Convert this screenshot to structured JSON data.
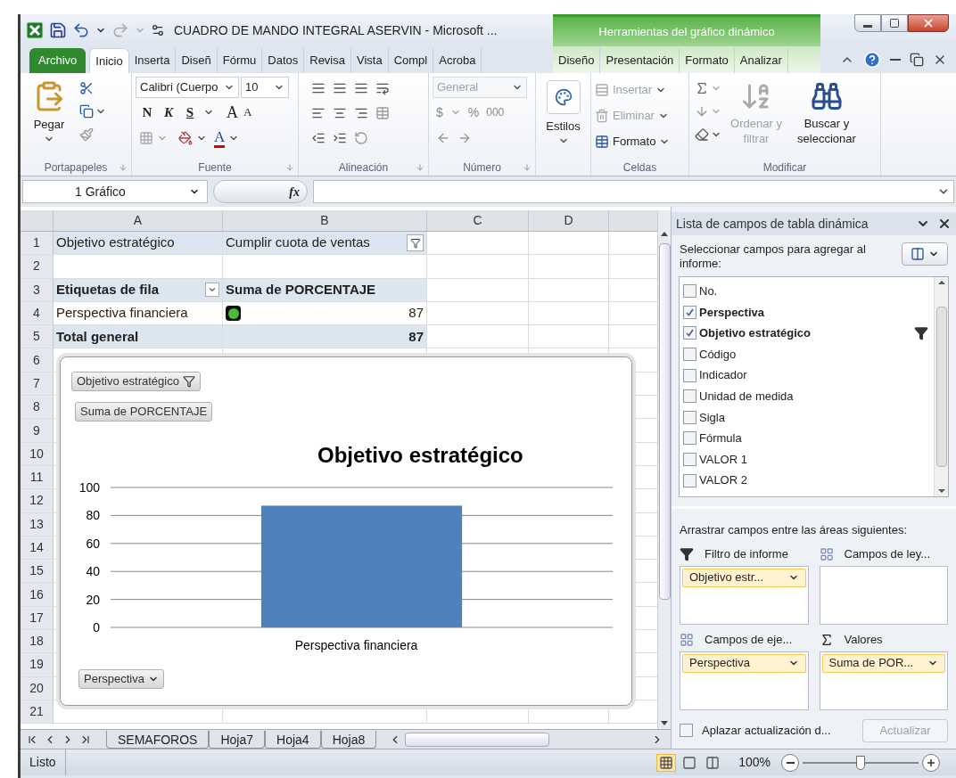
{
  "window": {
    "title": "CUADRO DE MANDO INTEGRAL ASERVIN  -  Microsoft ...",
    "context_title": "Herramientas del gráfico dinámico"
  },
  "ribbon_tabs": [
    {
      "label": "Archivo",
      "kind": "file",
      "selected": false
    },
    {
      "label": "Inicio",
      "kind": "tab",
      "selected": true
    },
    {
      "label": "Inserta",
      "kind": "tab",
      "selected": false
    },
    {
      "label": "Diseñ",
      "kind": "tab",
      "selected": false
    },
    {
      "label": "Fórmu",
      "kind": "tab",
      "selected": false
    },
    {
      "label": "Datos",
      "kind": "tab",
      "selected": false
    },
    {
      "label": "Revisa",
      "kind": "tab",
      "selected": false
    },
    {
      "label": "Vista",
      "kind": "tab",
      "selected": false
    },
    {
      "label": "Compl",
      "kind": "tab",
      "selected": false
    },
    {
      "label": "Acroba",
      "kind": "tab",
      "selected": false
    },
    {
      "label": "Diseño",
      "kind": "context",
      "selected": false
    },
    {
      "label": "Presentación",
      "kind": "context",
      "selected": false
    },
    {
      "label": "Formato",
      "kind": "context",
      "selected": false
    },
    {
      "label": "Analizar",
      "kind": "context",
      "selected": false
    }
  ],
  "ribbon": {
    "clipboard": {
      "label": "Portapapeles",
      "paste": "Pegar"
    },
    "font": {
      "label": "Fuente",
      "name": "Calibri (Cuerpo",
      "size": "10",
      "bold": "N",
      "italic": "K",
      "underline": "S",
      "grow": "A",
      "shrink": "A",
      "font_color_button": "A"
    },
    "alignment": {
      "label": "Alineación"
    },
    "number": {
      "label": "Número",
      "format": "General",
      "disabled": true,
      "currency": "$",
      "percent": "%",
      "thousands": "000"
    },
    "styles": {
      "label": "Estilos"
    },
    "cells": {
      "label": "Celdas",
      "items": [
        {
          "label": "Insertar",
          "disabled": true
        },
        {
          "label": "Eliminar",
          "disabled": true
        },
        {
          "label": "Formato",
          "disabled": false
        }
      ]
    },
    "editing": {
      "label": "Modificar",
      "sort": {
        "label": "Ordenar y filtrar",
        "disabled": true
      },
      "find": {
        "label": "Buscar y seleccionar",
        "disabled": false
      }
    }
  },
  "name_box": "1 Gráfico",
  "formula_label": "fx",
  "sheet": {
    "columns": [
      "A",
      "B",
      "C",
      "D"
    ],
    "rows": [
      {
        "number": "1",
        "kind": "filter",
        "label": "Objetivo estratégico",
        "value": "Cumplir cuota de ventas"
      },
      {
        "number": "2",
        "kind": "empty"
      },
      {
        "number": "3",
        "kind": "header",
        "label": "Etiquetas de fila",
        "value": "Suma de PORCENTAJE"
      },
      {
        "number": "4",
        "kind": "item",
        "label": "Perspectiva financiera",
        "value": "87"
      },
      {
        "number": "5",
        "kind": "total",
        "label": "Total general",
        "value": "87"
      },
      {
        "number": "6",
        "kind": "empty"
      },
      {
        "number": "7",
        "kind": "empty"
      },
      {
        "number": "8",
        "kind": "empty"
      },
      {
        "number": "9",
        "kind": "empty"
      },
      {
        "number": "10",
        "kind": "empty"
      },
      {
        "number": "11",
        "kind": "empty"
      },
      {
        "number": "12",
        "kind": "empty"
      },
      {
        "number": "13",
        "kind": "empty"
      },
      {
        "number": "14",
        "kind": "empty"
      },
      {
        "number": "15",
        "kind": "empty"
      },
      {
        "number": "16",
        "kind": "empty"
      },
      {
        "number": "17",
        "kind": "empty"
      },
      {
        "number": "18",
        "kind": "empty"
      },
      {
        "number": "19",
        "kind": "empty"
      },
      {
        "number": "20",
        "kind": "empty"
      },
      {
        "number": "21",
        "kind": "empty"
      }
    ]
  },
  "chart": {
    "field_buttons": [
      {
        "label": "Objetivo estratégico",
        "kind": "filter"
      },
      {
        "label": "Suma de PORCENTAJE",
        "kind": "value"
      },
      {
        "label": "Perspectiva",
        "kind": "axis"
      }
    ],
    "chart_data": {
      "type": "bar",
      "title": "Objetivo estratégico",
      "categories": [
        "Perspectiva financiera"
      ],
      "values": [
        87
      ],
      "grid": true,
      "ylim": [
        0,
        100
      ],
      "yticks": [
        0,
        20,
        40,
        60,
        80,
        100
      ]
    }
  },
  "field_list": {
    "title": "Lista de campos de tabla dinámica",
    "instruction": "Seleccionar campos para agregar al informe:",
    "fields": [
      {
        "label": "No.",
        "checked": false,
        "filtered": false
      },
      {
        "label": "Perspectiva",
        "checked": true,
        "filtered": false
      },
      {
        "label": "Objetivo estratégico",
        "checked": true,
        "filtered": true
      },
      {
        "label": "Código",
        "checked": false,
        "filtered": false
      },
      {
        "label": "Indicador",
        "checked": false,
        "filtered": false
      },
      {
        "label": "Unidad de medida",
        "checked": false,
        "filtered": false
      },
      {
        "label": "Sigla",
        "checked": false,
        "filtered": false
      },
      {
        "label": "Fórmula",
        "checked": false,
        "filtered": false
      },
      {
        "label": "VALOR 1",
        "checked": false,
        "filtered": false
      },
      {
        "label": "VALOR 2",
        "checked": false,
        "filtered": false
      }
    ],
    "areas_instruction": "Arrastrar campos entre las áreas siguientes:",
    "areas": [
      {
        "label": "Filtro de informe",
        "kind": "filter",
        "items": [
          "Objetivo estr..."
        ]
      },
      {
        "label": "Campos de ley...",
        "kind": "grid"
      },
      {
        "label": "Campos de eje...",
        "kind": "grid",
        "items": [
          "Perspectiva"
        ]
      },
      {
        "label": "Valores",
        "kind": "sigma",
        "items": [
          "Suma de POR..."
        ]
      }
    ],
    "defer": {
      "label": "Aplazar actualización d...",
      "checked": false
    },
    "update_button": {
      "label": "Actualizar",
      "disabled": true
    }
  },
  "sheet_tabs": [
    {
      "label": "SEMAFOROS",
      "selected": false
    },
    {
      "label": "Hoja7",
      "selected": false
    },
    {
      "label": "Hoja4",
      "selected": false
    },
    {
      "label": "Hoja8",
      "selected": false
    }
  ],
  "status_bar": {
    "text": "Listo",
    "views": [
      {
        "kind": "normal",
        "selected": true
      },
      {
        "kind": "page_layout",
        "selected": false
      },
      {
        "kind": "page_break",
        "selected": false
      }
    ],
    "zoom": "100%",
    "zoom_slider": {
      "level": 0.5
    }
  }
}
